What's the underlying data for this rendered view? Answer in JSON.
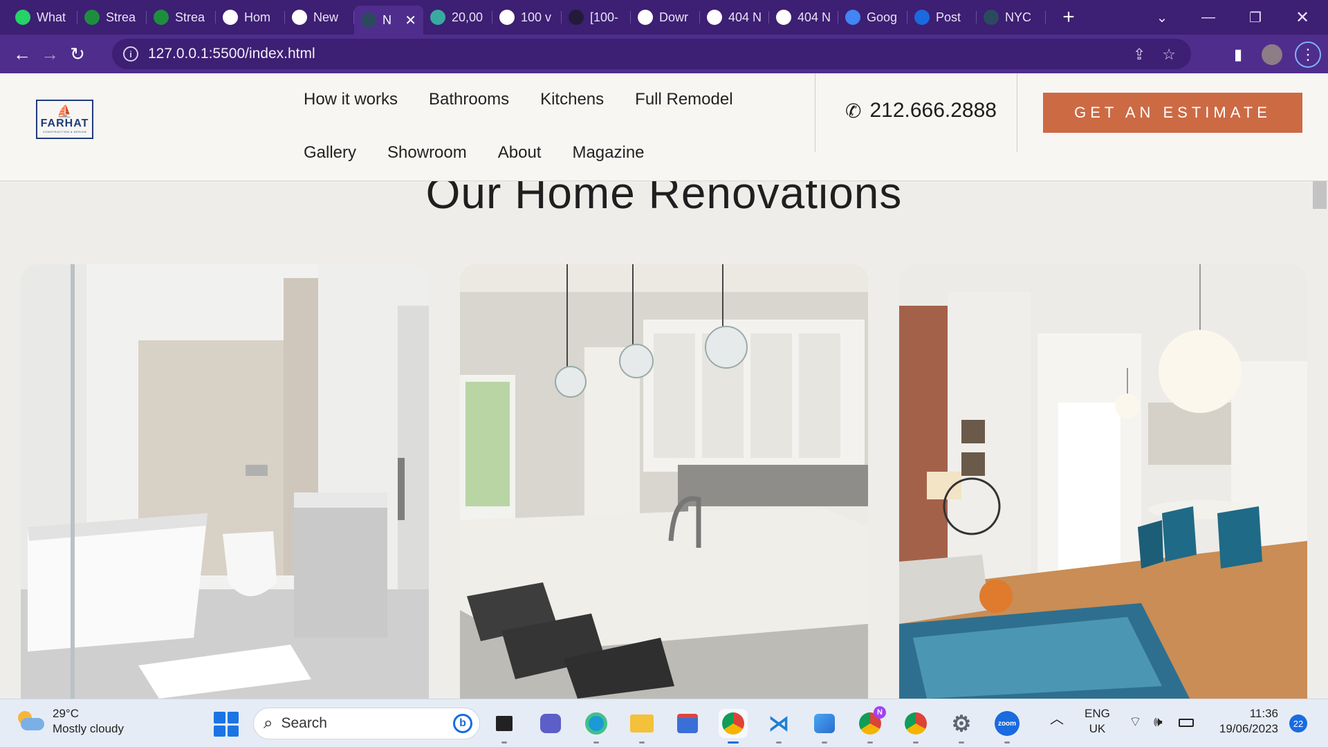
{
  "browser": {
    "tabs": [
      {
        "label": "What",
        "icon": "whatsapp-icon",
        "color": "#25d366"
      },
      {
        "label": "Strea",
        "icon": "classroom-icon",
        "color": "#1e8e3e"
      },
      {
        "label": "Strea",
        "icon": "classroom-icon",
        "color": "#1e8e3e"
      },
      {
        "label": "Hom",
        "icon": "globe-icon",
        "color": "#ffffff"
      },
      {
        "label": "New",
        "icon": "chrome-icon",
        "color": "#ffffff"
      },
      {
        "label": "N",
        "icon": "site-icon",
        "color": "#2c4a5e",
        "active": true
      },
      {
        "label": "20,00",
        "icon": "doc-icon",
        "color": "#3aa99f"
      },
      {
        "label": "100 v",
        "icon": "google-icon",
        "color": "#ffffff"
      },
      {
        "label": "[100-",
        "icon": "video-icon",
        "color": "#241a3a"
      },
      {
        "label": "Dowr",
        "icon": "download-icon",
        "color": "#ffffff"
      },
      {
        "label": "404 N",
        "icon": "globe-icon",
        "color": "#ffffff"
      },
      {
        "label": "404 N",
        "icon": "globe-icon",
        "color": "#ffffff"
      },
      {
        "label": "Goog",
        "icon": "calendar-icon",
        "color": "#4285f4"
      },
      {
        "label": "Post",
        "icon": "zoho-icon",
        "color": "#1a6ae0"
      },
      {
        "label": "NYC",
        "icon": "site-icon",
        "color": "#2c4a5e"
      }
    ],
    "tab_close": "✕",
    "new_tab": "+",
    "url": "127.0.0.1:5500/index.html"
  },
  "site": {
    "logo": {
      "name": "FARHAT",
      "tagline": "CONSTRUCTION & DESIGN"
    },
    "nav_row1": [
      "How it works",
      "Bathrooms",
      "Kitchens",
      "Full Remodel"
    ],
    "nav_row2": [
      "Gallery",
      "Showroom",
      "About",
      "Magazine"
    ],
    "phone": "212.666.2888",
    "cta": "GET AN ESTIMATE",
    "section_title": "Our Home Renovations",
    "cards": [
      {
        "name": "bathroom-photo"
      },
      {
        "name": "kitchen-photo"
      },
      {
        "name": "living-dining-photo"
      }
    ],
    "accent": "#cc6a44"
  },
  "taskbar": {
    "weather_temp": "29°C",
    "weather_desc": "Mostly cloudy",
    "search_placeholder": "Search",
    "lang_top": "ENG",
    "lang_bottom": "UK",
    "time": "11:36",
    "date": "19/06/2023",
    "notifications": "22",
    "zoom_label": "zoom",
    "chrome_badge": "N"
  }
}
